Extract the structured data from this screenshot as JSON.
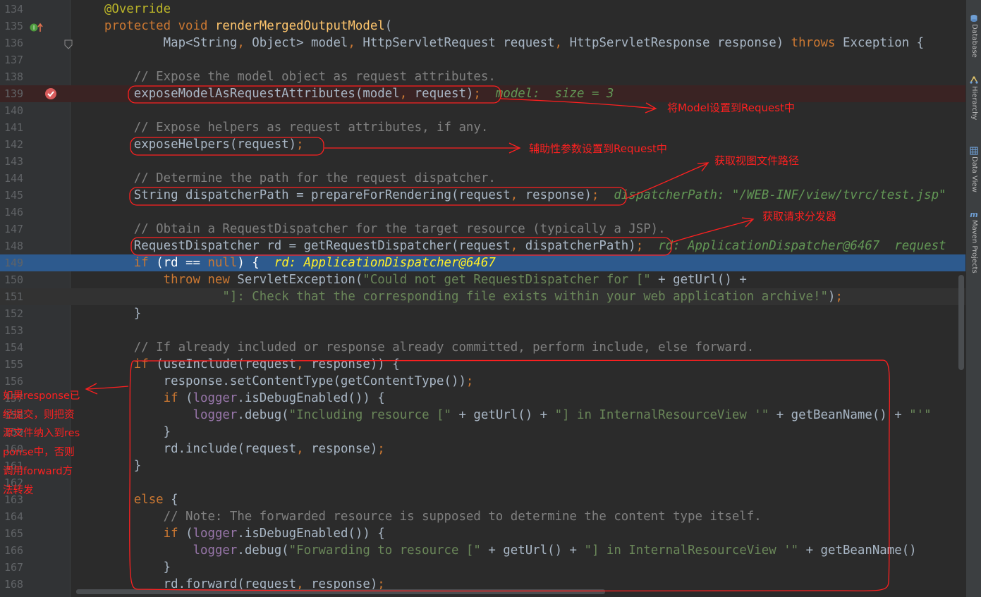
{
  "editor": {
    "lines": [
      {
        "num": "134",
        "tokens": [
          {
            "t": "    "
          },
          {
            "t": "@Override",
            "c": "ann"
          }
        ]
      },
      {
        "num": "135",
        "tokens": [
          {
            "t": "    "
          },
          {
            "t": "protected void ",
            "c": "kw"
          },
          {
            "t": "renderMergedOutputModel",
            "c": "fn"
          },
          {
            "t": "("
          }
        ]
      },
      {
        "num": "136",
        "tokens": [
          {
            "t": "            Map<String"
          },
          {
            "t": ", ",
            "c": "kw"
          },
          {
            "t": "Object> model"
          },
          {
            "t": ", ",
            "c": "kw"
          },
          {
            "t": "HttpServletRequest request"
          },
          {
            "t": ", ",
            "c": "kw"
          },
          {
            "t": "HttpServletResponse response) "
          },
          {
            "t": "throws ",
            "c": "kw"
          },
          {
            "t": "Exception {"
          }
        ]
      },
      {
        "num": "137",
        "tokens": []
      },
      {
        "num": "138",
        "tokens": [
          {
            "t": "        "
          },
          {
            "t": "// Expose the model object as request attributes.",
            "c": "cm"
          }
        ]
      },
      {
        "num": "139",
        "tokens": [
          {
            "t": "        exposeModelAsRequestAttributes(model"
          },
          {
            "t": ", ",
            "c": "kw"
          },
          {
            "t": "request)"
          },
          {
            "t": ";",
            "c": "kw"
          },
          {
            "t": "  "
          },
          {
            "t": "model:  size = 3",
            "c": "hint"
          }
        ]
      },
      {
        "num": "140",
        "tokens": []
      },
      {
        "num": "141",
        "tokens": [
          {
            "t": "        "
          },
          {
            "t": "// Expose helpers as request attributes, if any.",
            "c": "cm"
          }
        ]
      },
      {
        "num": "142",
        "tokens": [
          {
            "t": "        exposeHelpers(request)"
          },
          {
            "t": ";",
            "c": "kw"
          }
        ]
      },
      {
        "num": "143",
        "tokens": []
      },
      {
        "num": "144",
        "tokens": [
          {
            "t": "        "
          },
          {
            "t": "// Determine the path for the request dispatcher.",
            "c": "cm"
          }
        ]
      },
      {
        "num": "145",
        "tokens": [
          {
            "t": "        String dispatcherPath = prepareForRendering(request"
          },
          {
            "t": ", ",
            "c": "kw"
          },
          {
            "t": "response)"
          },
          {
            "t": ";",
            "c": "kw"
          },
          {
            "t": "  "
          },
          {
            "t": "dispatcherPath: \"/WEB-INF/view/tvrc/test.jsp\"",
            "c": "hint"
          }
        ]
      },
      {
        "num": "146",
        "tokens": []
      },
      {
        "num": "147",
        "tokens": [
          {
            "t": "        "
          },
          {
            "t": "// Obtain a RequestDispatcher for the target resource (typically a JSP).",
            "c": "cm"
          }
        ]
      },
      {
        "num": "148",
        "tokens": [
          {
            "t": "        RequestDispatcher rd = getRequestDispatcher(request"
          },
          {
            "t": ", ",
            "c": "kw"
          },
          {
            "t": "dispatcherPath)"
          },
          {
            "t": ";",
            "c": "kw"
          },
          {
            "t": "  "
          },
          {
            "t": "rd: ApplicationDispatcher@6467  request",
            "c": "hint"
          }
        ]
      },
      {
        "num": "149",
        "tokens": [
          {
            "t": "        "
          },
          {
            "t": "if ",
            "c": "kw"
          },
          {
            "t": "(rd == "
          },
          {
            "t": "null",
            "c": "kw"
          },
          {
            "t": ") {  "
          },
          {
            "t": "rd: ApplicationDispatcher@6467",
            "c": "hint-exec"
          }
        ]
      },
      {
        "num": "150",
        "tokens": [
          {
            "t": "            "
          },
          {
            "t": "throw new ",
            "c": "kw"
          },
          {
            "t": "ServletException("
          },
          {
            "t": "\"Could not get RequestDispatcher for [\"",
            "c": "str"
          },
          {
            "t": " + getUrl() +"
          }
        ]
      },
      {
        "num": "151",
        "tokens": [
          {
            "t": "                    "
          },
          {
            "t": "\"]: Check that the corresponding file exists within your web application archive!\"",
            "c": "str"
          },
          {
            "t": ")"
          },
          {
            "t": ";",
            "c": "kw"
          }
        ]
      },
      {
        "num": "152",
        "tokens": [
          {
            "t": "        }"
          }
        ]
      },
      {
        "num": "153",
        "tokens": []
      },
      {
        "num": "154",
        "tokens": [
          {
            "t": "        "
          },
          {
            "t": "// If already included or response already committed, perform include, else forward.",
            "c": "cm"
          }
        ]
      },
      {
        "num": "155",
        "tokens": [
          {
            "t": "        "
          },
          {
            "t": "if ",
            "c": "kw"
          },
          {
            "t": "(useInclude(request"
          },
          {
            "t": ", ",
            "c": "kw"
          },
          {
            "t": "response)) {"
          }
        ]
      },
      {
        "num": "156",
        "tokens": [
          {
            "t": "            response.setContentType(getContentType())"
          },
          {
            "t": ";",
            "c": "kw"
          }
        ]
      },
      {
        "num": "157",
        "tokens": [
          {
            "t": "            "
          },
          {
            "t": "if ",
            "c": "kw"
          },
          {
            "t": "("
          },
          {
            "t": "logger",
            "c": "fld"
          },
          {
            "t": ".isDebugEnabled()) {"
          }
        ]
      },
      {
        "num": "158",
        "tokens": [
          {
            "t": "                "
          },
          {
            "t": "logger",
            "c": "fld"
          },
          {
            "t": ".debug("
          },
          {
            "t": "\"Including resource [\"",
            "c": "str"
          },
          {
            "t": " + getUrl() + "
          },
          {
            "t": "\"] in InternalResourceView '\"",
            "c": "str"
          },
          {
            "t": " + getBeanName() + "
          },
          {
            "t": "\"'\"",
            "c": "str"
          }
        ]
      },
      {
        "num": "159",
        "tokens": [
          {
            "t": "            }"
          }
        ]
      },
      {
        "num": "160",
        "tokens": [
          {
            "t": "            rd.include(request"
          },
          {
            "t": ", ",
            "c": "kw"
          },
          {
            "t": "response)"
          },
          {
            "t": ";",
            "c": "kw"
          }
        ]
      },
      {
        "num": "161",
        "tokens": [
          {
            "t": "        }"
          }
        ]
      },
      {
        "num": "162",
        "tokens": []
      },
      {
        "num": "163",
        "tokens": [
          {
            "t": "        "
          },
          {
            "t": "else ",
            "c": "kw"
          },
          {
            "t": "{"
          }
        ]
      },
      {
        "num": "164",
        "tokens": [
          {
            "t": "            "
          },
          {
            "t": "// Note: The forwarded resource is supposed to determine the content type itself.",
            "c": "cm"
          }
        ]
      },
      {
        "num": "165",
        "tokens": [
          {
            "t": "            "
          },
          {
            "t": "if ",
            "c": "kw"
          },
          {
            "t": "("
          },
          {
            "t": "logger",
            "c": "fld"
          },
          {
            "t": ".isDebugEnabled()) {"
          }
        ]
      },
      {
        "num": "166",
        "tokens": [
          {
            "t": "                "
          },
          {
            "t": "logger",
            "c": "fld"
          },
          {
            "t": ".debug("
          },
          {
            "t": "\"Forwarding to resource [\"",
            "c": "str"
          },
          {
            "t": " + getUrl() + "
          },
          {
            "t": "\"] in InternalResourceView '\"",
            "c": "str"
          },
          {
            "t": " + getBeanName()"
          }
        ]
      },
      {
        "num": "167",
        "tokens": [
          {
            "t": "            }"
          }
        ]
      },
      {
        "num": "168",
        "tokens": [
          {
            "t": "            rd.forward(request"
          },
          {
            "t": ", ",
            "c": "kw"
          },
          {
            "t": "response)"
          },
          {
            "t": ";",
            "c": "kw"
          }
        ]
      }
    ],
    "breakpoint_line": "139",
    "execution_line": "149"
  },
  "tool_windows": [
    {
      "label": "Database",
      "icon": "database-icon"
    },
    {
      "label": "Hierarchy",
      "icon": "hierarchy-icon"
    },
    {
      "label": "Data View",
      "icon": "table-icon"
    },
    {
      "label": "Maven Projects",
      "icon": "maven-icon"
    }
  ],
  "annotations": {
    "note1": "将Model设置到Request中",
    "note2": "辅助性参数设置到Request中",
    "note3": "获取视图文件路径",
    "note4": "获取请求分发器",
    "side_note": "如果response已经提交，则把资源文件纳入到response中，否则调用forward方法转发"
  },
  "colors": {
    "background": "#2b2b2b",
    "gutter": "#313335",
    "execution_highlight": "#2d5a8e",
    "annotation_red": "#ff2020"
  }
}
